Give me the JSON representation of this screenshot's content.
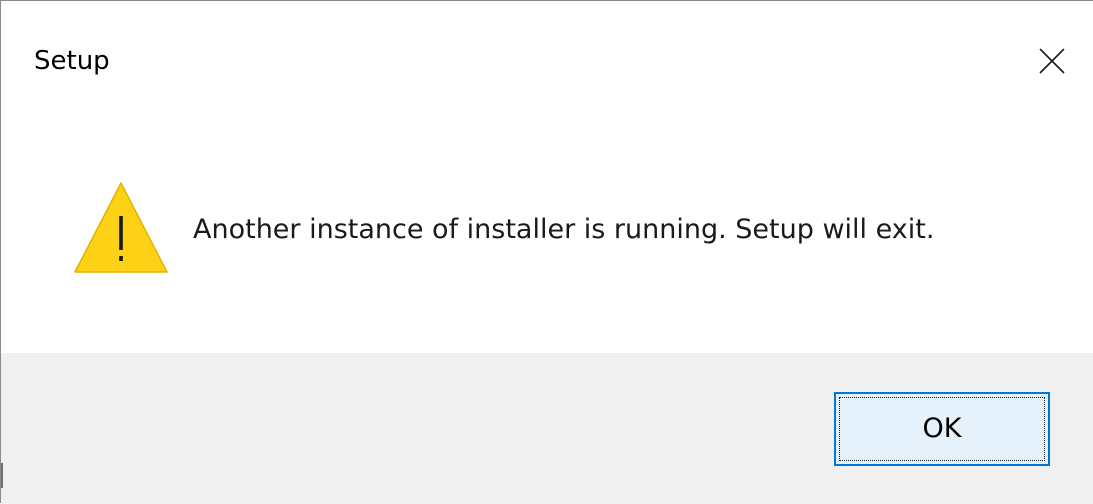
{
  "dialog": {
    "title": "Setup",
    "close_icon": "close-icon",
    "message": "Another instance of installer is running. Setup will exit.",
    "icon": "warning-icon",
    "ok_label": "OK"
  },
  "colors": {
    "warning_fill": "#fcd116",
    "footer_background": "#f0f0f0",
    "button_border": "#0078d7",
    "button_background": "#e5f1fb"
  }
}
